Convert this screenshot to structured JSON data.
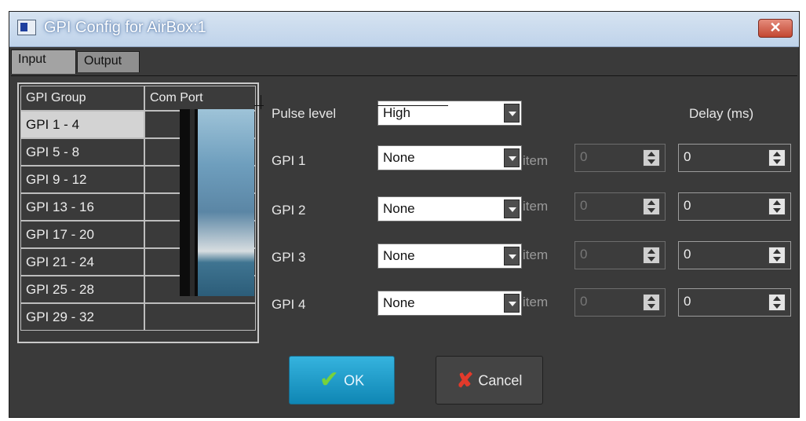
{
  "window": {
    "title": "GPI Config for AirBox:1",
    "close_glyph": "✕"
  },
  "tabs": [
    {
      "label": "Input",
      "active": true
    },
    {
      "label": "Output",
      "active": false
    }
  ],
  "group_table": {
    "headers": [
      "GPI Group",
      "Com Port"
    ],
    "selected_index": 0,
    "rows": [
      {
        "group": "GPI 1 - 4",
        "com_port": ""
      },
      {
        "group": "GPI 5 - 8",
        "com_port": ""
      },
      {
        "group": "GPI 9 - 12",
        "com_port": ""
      },
      {
        "group": "GPI 13 - 16",
        "com_port": ""
      },
      {
        "group": "GPI 17 - 20",
        "com_port": ""
      },
      {
        "group": "GPI 21 - 24",
        "com_port": ""
      },
      {
        "group": "GPI 25 - 28",
        "com_port": ""
      },
      {
        "group": "GPI 29 - 32",
        "com_port": ""
      }
    ]
  },
  "config": {
    "pulse_level_label": "Pulse level",
    "pulse_level_value": "High",
    "delay_header": "Delay (ms)",
    "item_label": "item",
    "gpis": [
      {
        "label": "GPI 1",
        "value": "None",
        "item": "0",
        "delay": "0"
      },
      {
        "label": "GPI 2",
        "value": "None",
        "item": "0",
        "delay": "0"
      },
      {
        "label": "GPI 3",
        "value": "None",
        "item": "0",
        "delay": "0"
      },
      {
        "label": "GPI 4",
        "value": "None",
        "item": "0",
        "delay": "0"
      }
    ]
  },
  "buttons": {
    "ok_label": "OK",
    "cancel_label": "Cancel"
  },
  "icons": {
    "window": "window-icon",
    "close": "close-icon",
    "ok": "checkmark-icon",
    "cancel": "x-icon"
  },
  "colors": {
    "background": "#3a3a3a",
    "ok_button": "#1a9ccc",
    "check_green": "#77d23b",
    "cancel_red": "#e33a2b"
  }
}
